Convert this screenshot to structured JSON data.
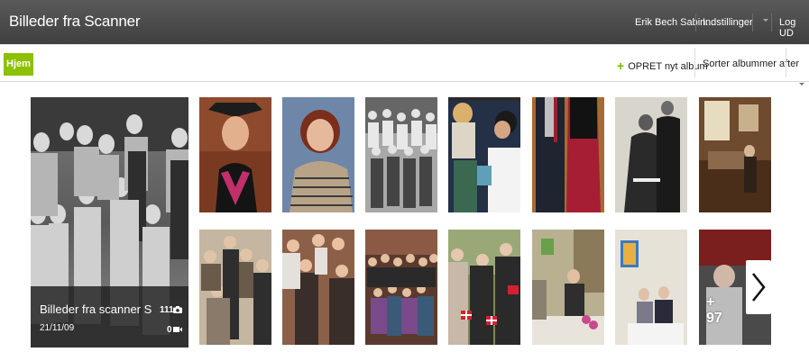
{
  "header": {
    "app_title": "Billeder fra Scanner",
    "user_name": "Erik Bech Sabin...",
    "settings_label": "Indstillinger",
    "logout_label": "Log UD"
  },
  "toolbar": {
    "home_label": "Hjem",
    "create_album_label": "OPRET nyt album",
    "sort_label": "Sorter albummer after",
    "accent_color": "#8cc000"
  },
  "featured_album": {
    "title": "Billeder fra scanner S...",
    "date": "21/11/09",
    "photo_count": "111",
    "video_count": "0"
  },
  "grid": {
    "more_plus": "+",
    "more_count": "97"
  },
  "icons": {
    "camera": "camera-icon",
    "video": "video-icon",
    "next": "chevron-right-icon",
    "plus": "plus-icon"
  }
}
